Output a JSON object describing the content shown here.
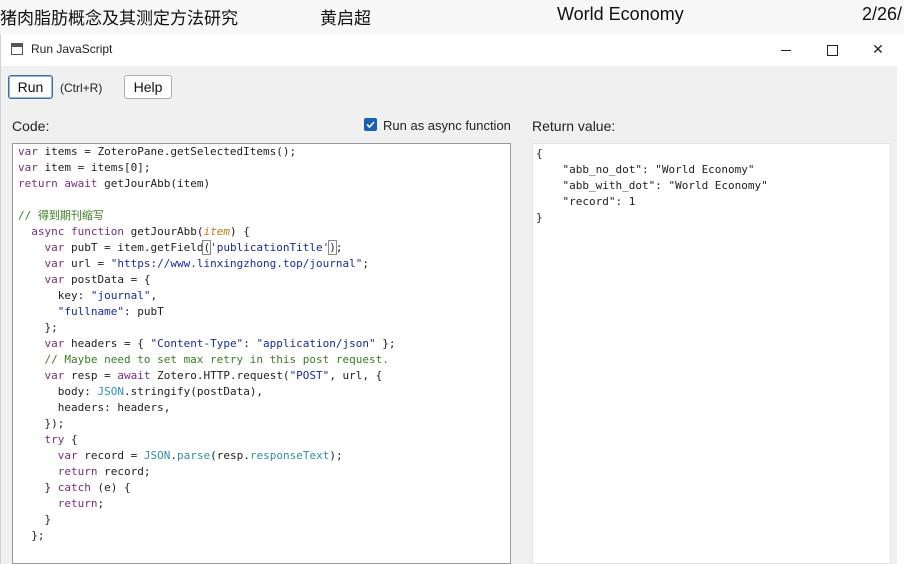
{
  "background_app": {
    "cells": [
      "猪肉脂肪概念及其测定方法研究",
      "黄启超",
      "World Economy",
      "2/26/"
    ]
  },
  "window": {
    "title": "Run JavaScript",
    "icon": "window-app-icon",
    "minimize_icon": "minimize-icon",
    "maximize_icon": "maximize-icon",
    "close_glyph": "✕"
  },
  "toolbar": {
    "run_label": "Run",
    "shortcut": "(Ctrl+R)",
    "help_label": "Help"
  },
  "code_panel": {
    "label": "Code:",
    "async_checkbox_label": "Run as async function",
    "async_checked": true
  },
  "return_panel": {
    "label": "Return value:",
    "lines": [
      "{",
      "    \"abb_no_dot\": \"World Economy\"",
      "    \"abb_with_dot\": \"World Economy\"",
      "    \"record\": 1",
      "}"
    ]
  },
  "code_lines": [
    "var items = ZoteroPane.getSelectedItems();",
    "var item = items[0];",
    "return await getJourAbb(item)",
    "",
    "// 得到期刊缩写",
    "  async function getJourAbb(item) {",
    "    var pubT = item.getField('publicationTitle');",
    "    var url = \"https://www.linxingzhong.top/journal\";",
    "    var postData = {",
    "      key: \"journal\",",
    "      \"fullname\": pubT",
    "    };",
    "    var headers = { \"Content-Type\": \"application/json\" };",
    "    // Maybe need to set max retry in this post request.",
    "    var resp = await Zotero.HTTP.request(\"POST\", url, {",
    "      body: JSON.stringify(postData),",
    "      headers: headers,",
    "    });",
    "    try {",
    "      var record = JSON.parse(resp.responseText);",
    "      return record;",
    "    } catch (e) {",
    "      return;",
    "    }",
    "  };"
  ]
}
